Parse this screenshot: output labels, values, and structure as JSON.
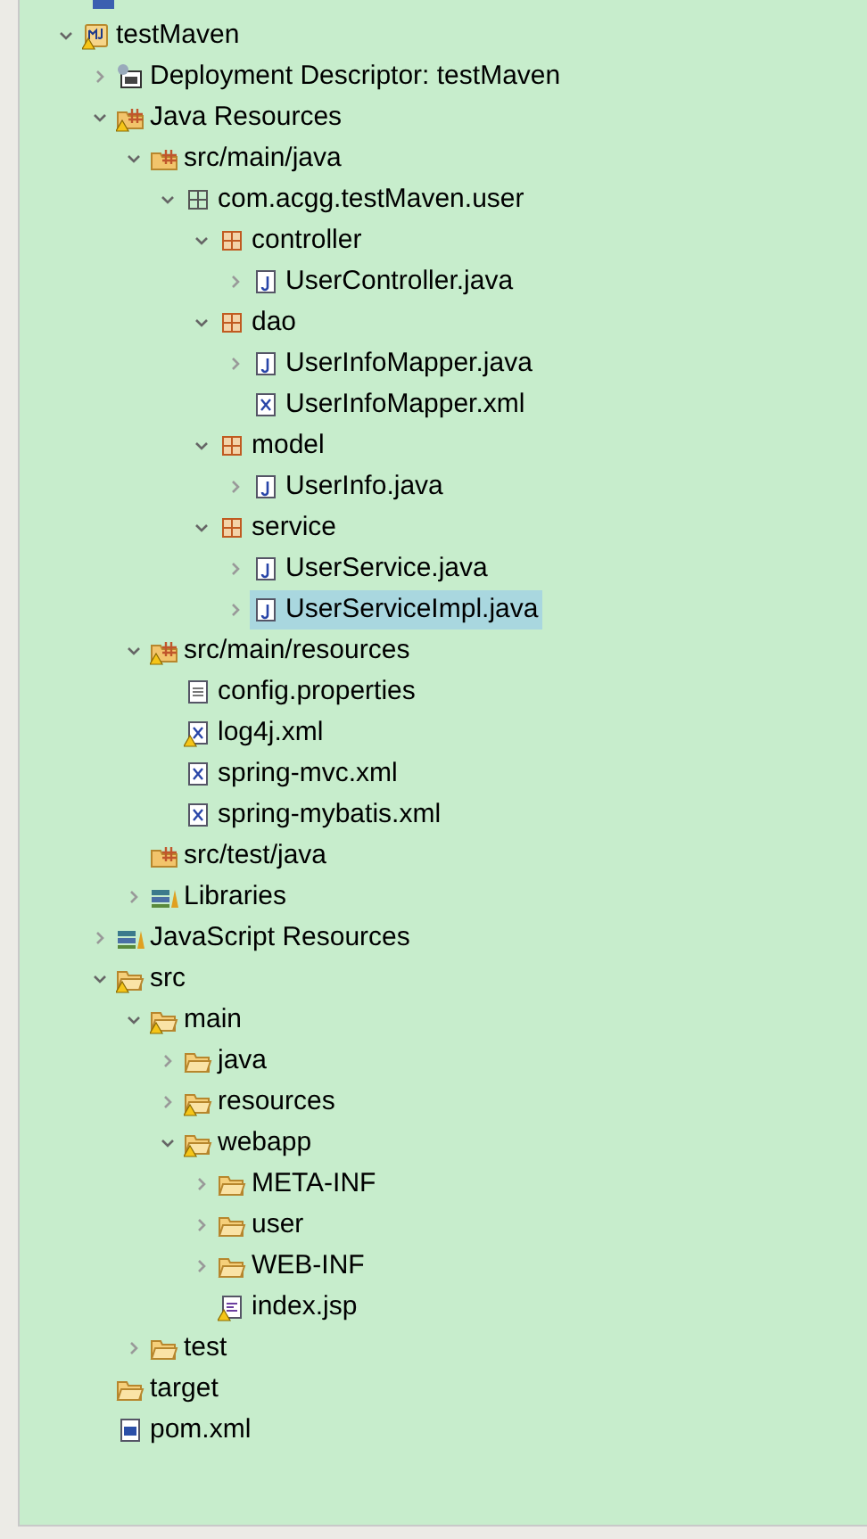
{
  "tree": [
    {
      "label": "testMaven",
      "kind": "project",
      "warning": true,
      "expanded": true,
      "selected": false,
      "children": [
        {
          "label": "Deployment Descriptor: testMaven",
          "kind": "descriptor",
          "warning": false,
          "expanded": false,
          "selected": false
        },
        {
          "label": "Java Resources",
          "kind": "java-resources",
          "warning": true,
          "expanded": true,
          "selected": false,
          "children": [
            {
              "label": "src/main/java",
              "kind": "source-folder",
              "warning": false,
              "expanded": true,
              "selected": false,
              "children": [
                {
                  "label": "com.acgg.testMaven.user",
                  "kind": "empty-package",
                  "warning": false,
                  "expanded": true,
                  "selected": false,
                  "children": [
                    {
                      "label": "controller",
                      "kind": "package",
                      "warning": false,
                      "expanded": true,
                      "selected": false,
                      "children": [
                        {
                          "label": "UserController.java",
                          "kind": "java-file",
                          "warning": false,
                          "expanded": false,
                          "selected": false
                        }
                      ]
                    },
                    {
                      "label": "dao",
                      "kind": "package",
                      "warning": false,
                      "expanded": true,
                      "selected": false,
                      "children": [
                        {
                          "label": "UserInfoMapper.java",
                          "kind": "java-file",
                          "warning": false,
                          "expanded": false,
                          "selected": false
                        },
                        {
                          "label": "UserInfoMapper.xml",
                          "kind": "xml-file",
                          "warning": false,
                          "selected": false
                        }
                      ]
                    },
                    {
                      "label": "model",
                      "kind": "package",
                      "warning": false,
                      "expanded": true,
                      "selected": false,
                      "children": [
                        {
                          "label": "UserInfo.java",
                          "kind": "java-file",
                          "warning": false,
                          "expanded": false,
                          "selected": false
                        }
                      ]
                    },
                    {
                      "label": "service",
                      "kind": "package",
                      "warning": false,
                      "expanded": true,
                      "selected": false,
                      "children": [
                        {
                          "label": "UserService.java",
                          "kind": "java-file",
                          "warning": false,
                          "expanded": false,
                          "selected": false
                        },
                        {
                          "label": "UserServiceImpl.java",
                          "kind": "java-file",
                          "warning": false,
                          "expanded": false,
                          "selected": true
                        }
                      ]
                    }
                  ]
                }
              ]
            },
            {
              "label": "src/main/resources",
              "kind": "source-folder",
              "warning": true,
              "expanded": true,
              "selected": false,
              "children": [
                {
                  "label": "config.properties",
                  "kind": "text-file",
                  "warning": false,
                  "selected": false
                },
                {
                  "label": "log4j.xml",
                  "kind": "xml-file",
                  "warning": true,
                  "selected": false
                },
                {
                  "label": "spring-mvc.xml",
                  "kind": "xml-file",
                  "warning": false,
                  "selected": false
                },
                {
                  "label": "spring-mybatis.xml",
                  "kind": "xml-file",
                  "warning": false,
                  "selected": false
                }
              ]
            },
            {
              "label": "src/test/java",
              "kind": "source-folder",
              "warning": false,
              "selected": false
            },
            {
              "label": "Libraries",
              "kind": "libraries",
              "warning": false,
              "expanded": false,
              "selected": false
            }
          ]
        },
        {
          "label": "JavaScript Resources",
          "kind": "libraries",
          "warning": false,
          "expanded": false,
          "selected": false
        },
        {
          "label": "src",
          "kind": "folder",
          "warning": true,
          "expanded": true,
          "selected": false,
          "children": [
            {
              "label": "main",
              "kind": "folder",
              "warning": true,
              "expanded": true,
              "selected": false,
              "children": [
                {
                  "label": "java",
                  "kind": "folder",
                  "warning": false,
                  "expanded": false,
                  "selected": false
                },
                {
                  "label": "resources",
                  "kind": "folder",
                  "warning": true,
                  "expanded": false,
                  "selected": false
                },
                {
                  "label": "webapp",
                  "kind": "folder",
                  "warning": true,
                  "expanded": true,
                  "selected": false,
                  "children": [
                    {
                      "label": "META-INF",
                      "kind": "folder",
                      "warning": false,
                      "expanded": false,
                      "selected": false
                    },
                    {
                      "label": "user",
                      "kind": "folder",
                      "warning": false,
                      "expanded": false,
                      "selected": false
                    },
                    {
                      "label": "WEB-INF",
                      "kind": "folder",
                      "warning": false,
                      "expanded": false,
                      "selected": false
                    },
                    {
                      "label": "index.jsp",
                      "kind": "jsp-file",
                      "warning": true,
                      "selected": false
                    }
                  ]
                }
              ]
            },
            {
              "label": "test",
              "kind": "folder",
              "warning": false,
              "expanded": false,
              "selected": false
            }
          ]
        },
        {
          "label": "target",
          "kind": "folder",
          "warning": false,
          "selected": false
        },
        {
          "label": "pom.xml",
          "kind": "maven-file",
          "warning": false,
          "selected": false
        }
      ]
    }
  ]
}
